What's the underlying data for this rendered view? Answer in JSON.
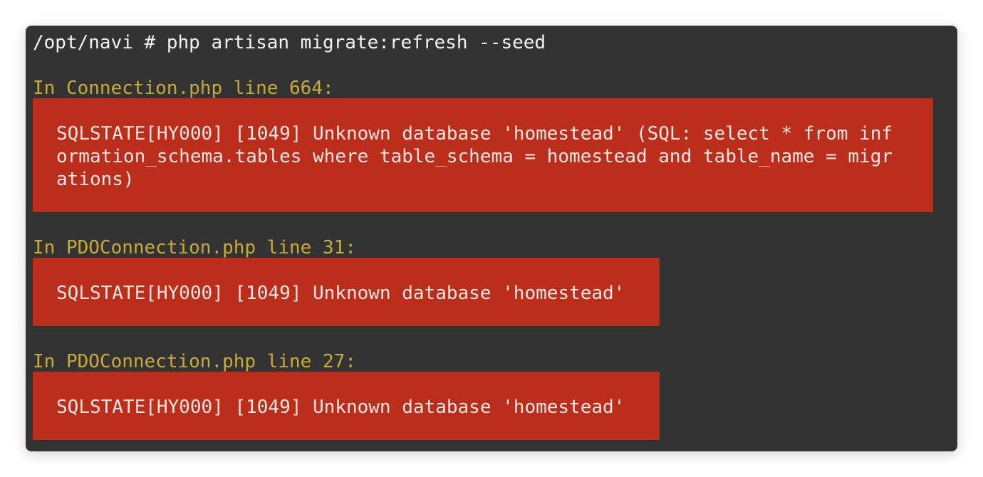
{
  "terminal": {
    "command": "/opt/navi # php artisan migrate:refresh --seed",
    "errors": [
      {
        "heading": "In Connection.php line 664:",
        "lines": [
          "SQLSTATE[HY000] [1049] Unknown database 'homestead' (SQL: select * from inf",
          "ormation_schema.tables where table_schema = homestead and table_name = migr",
          "ations)"
        ]
      },
      {
        "heading": "In PDOConnection.php line 31:",
        "lines": [
          "SQLSTATE[HY000] [1049] Unknown database 'homestead'"
        ]
      },
      {
        "heading": "In PDOConnection.php line 27:",
        "lines": [
          "SQLSTATE[HY000] [1049] Unknown database 'homestead'"
        ]
      }
    ],
    "colors": {
      "background": "#333333",
      "heading": "#c8ab36",
      "error_background": "#bb2e1b",
      "text": "#f3f3f3"
    }
  }
}
